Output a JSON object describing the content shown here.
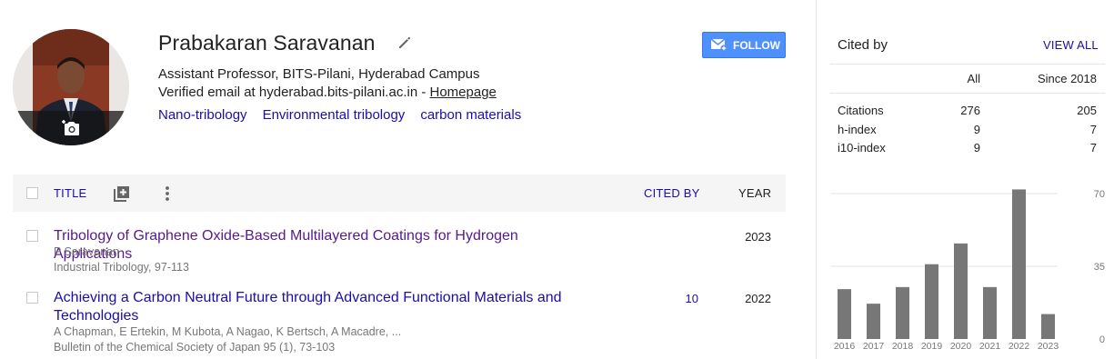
{
  "profile": {
    "name": "Prabakaran Saravanan",
    "affiliation": "Assistant Professor, BITS-Pilani, Hyderabad Campus",
    "email_text": "Verified email at hyderabad.bits-pilani.ac.in - ",
    "homepage_label": "Homepage",
    "interests": [
      "Nano-tribology",
      "Environmental tribology",
      "carbon materials"
    ]
  },
  "follow_button": {
    "label": "FOLLOW",
    "color": "#4d90fe"
  },
  "table": {
    "headers": {
      "title": "TITLE",
      "cited_by": "CITED BY",
      "year": "YEAR"
    },
    "rows": [
      {
        "title": "Tribology of Graphene Oxide-Based Multilayered Coatings for Hydrogen Applications",
        "authors": "P Saravanan",
        "venue": "Industrial Tribology, 97-113",
        "cited_by": "",
        "year": "2023"
      },
      {
        "title": "Achieving a Carbon Neutral Future through Advanced Functional Materials and Technologies",
        "authors": "A Chapman, E Ertekin, M Kubota, A Nagao, K Bertsch, A Macadre, ...",
        "venue": "Bulletin of the Chemical Society of Japan 95 (1), 73-103",
        "cited_by": "10",
        "year": "2022"
      }
    ]
  },
  "cited_by_panel": {
    "title": "Cited by",
    "view_all": "VIEW ALL",
    "col_all": "All",
    "col_since": "Since 2018",
    "stats": [
      {
        "label": "Citations",
        "all": "276",
        "since": "205"
      },
      {
        "label": "h-index",
        "all": "9",
        "since": "7"
      },
      {
        "label": "i10-index",
        "all": "9",
        "since": "7"
      }
    ]
  },
  "chart_data": {
    "type": "bar",
    "categories": [
      "2016",
      "2017",
      "2018",
      "2019",
      "2020",
      "2021",
      "2022",
      "2023"
    ],
    "values": [
      24,
      17,
      25,
      36,
      46,
      25,
      72,
      12
    ],
    "ylim": [
      0,
      70
    ],
    "y_ticks": [
      "0",
      "35",
      "70"
    ],
    "bar_color": "#777777",
    "grid": true
  }
}
